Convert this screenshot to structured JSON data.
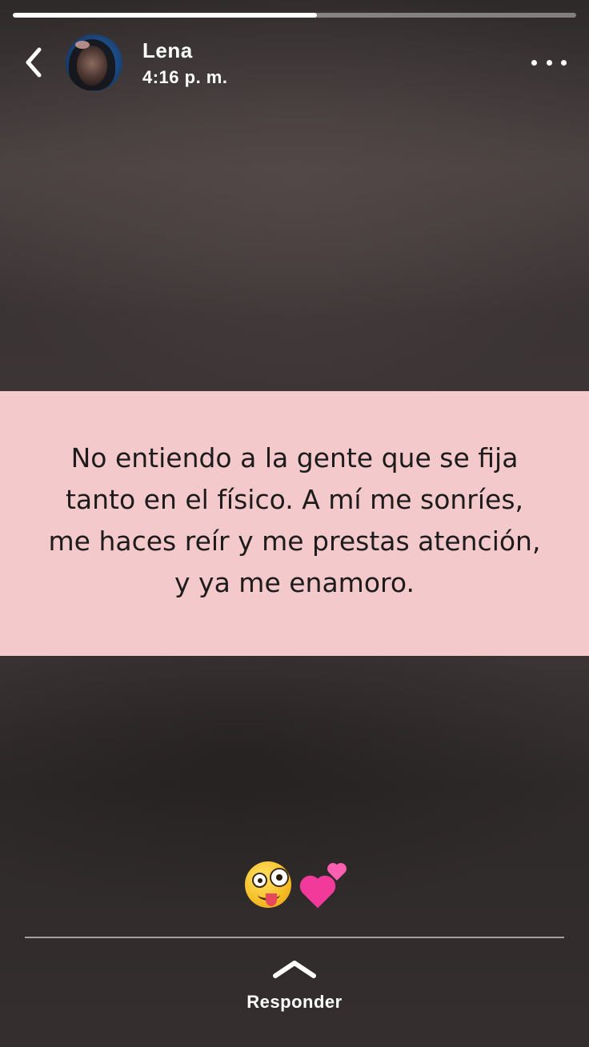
{
  "story": {
    "progress": 0.54
  },
  "header": {
    "user_name": "Lena",
    "timestamp": "4:16 p. m.",
    "back_icon": "chevron-left-icon",
    "more_icon": "ellipsis-icon"
  },
  "post": {
    "quote_lines": [
      "No entiendo a la gente que se fija",
      "tanto en el físico. A mí me sonríes,",
      "me haces reír y me prestas atención,",
      "y ya me enamoro."
    ],
    "card_color": "#f3c9cb"
  },
  "reactions": {
    "emojis": [
      "zany-face-emoji",
      "two-hearts-emoji"
    ]
  },
  "footer": {
    "reply_label": "Responder",
    "reply_icon": "chevron-up-icon"
  }
}
